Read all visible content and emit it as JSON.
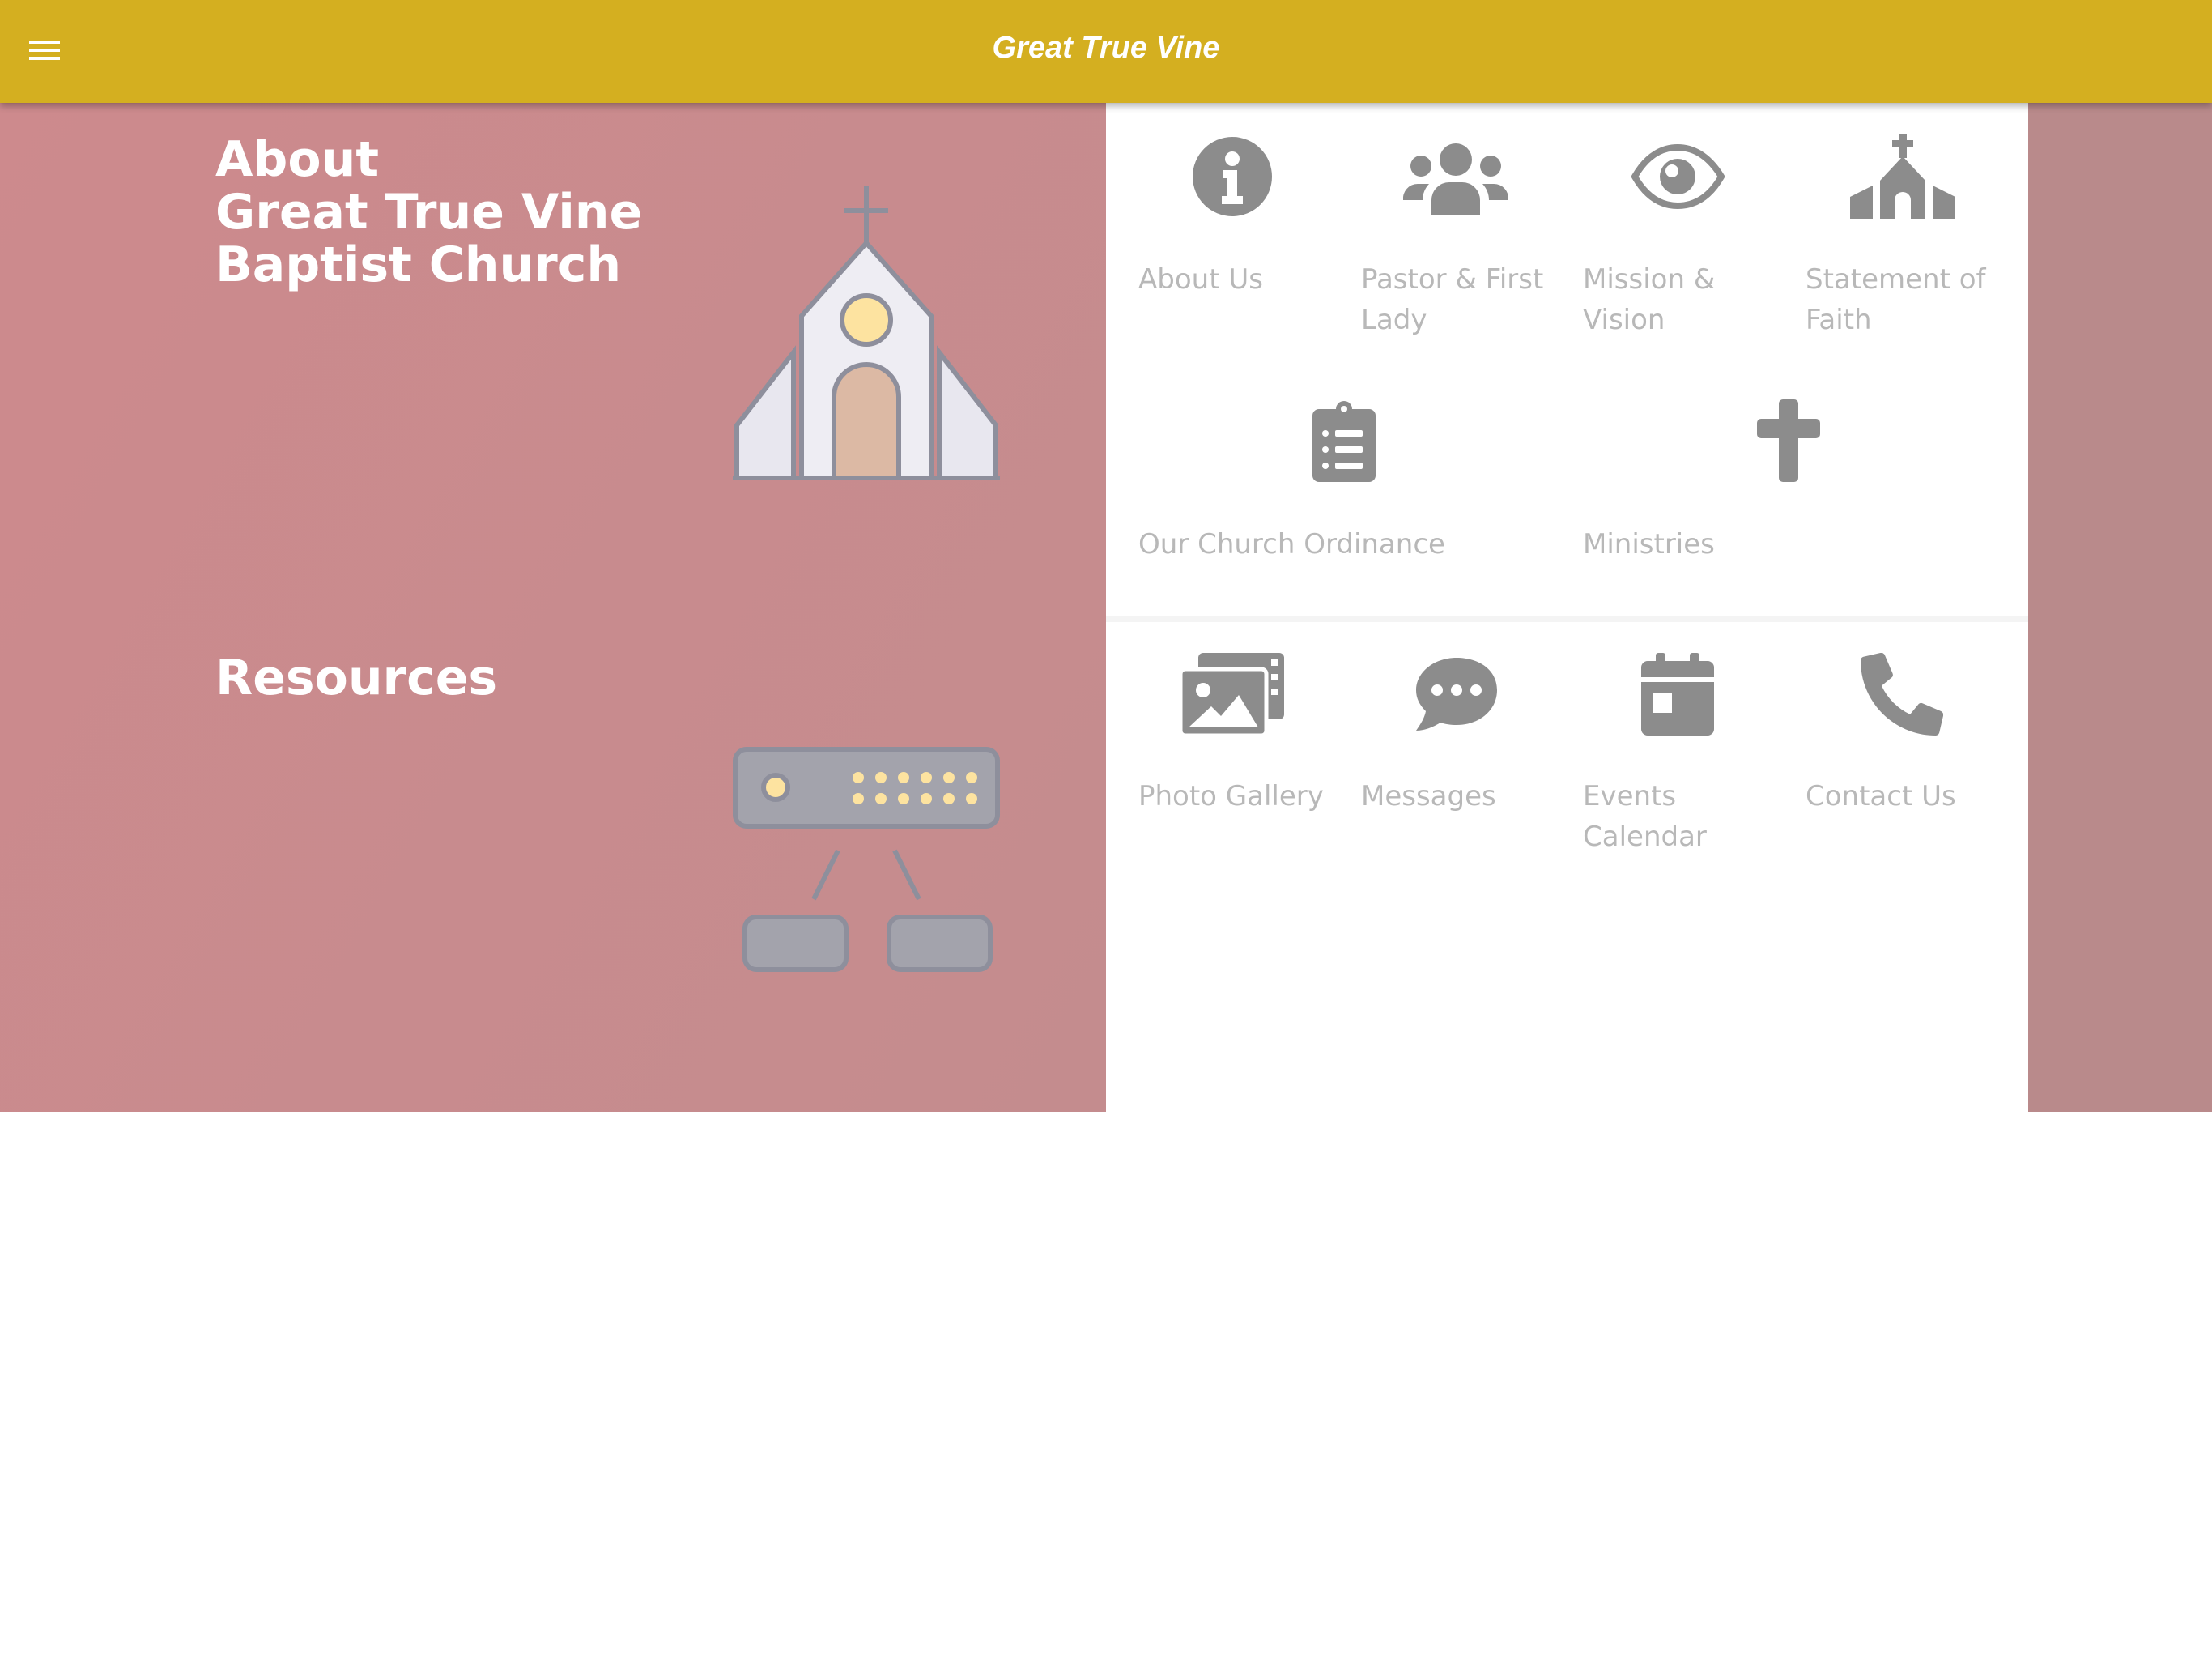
{
  "header": {
    "title": "Great True Vine",
    "menu_icon": "hamburger-menu-icon"
  },
  "about": {
    "heading_lines": [
      "About",
      "Great True Vine",
      "Baptist Church"
    ]
  },
  "resources": {
    "heading": "Resources"
  },
  "about_items": [
    {
      "label_lines": [
        "About Us"
      ],
      "icon": "info-circle-icon"
    },
    {
      "label_lines": [
        "Pastor & First",
        "Lady"
      ],
      "icon": "users-icon"
    },
    {
      "label_lines": [
        "Mission &",
        "Vision"
      ],
      "icon": "eye-icon"
    },
    {
      "label_lines": [
        "Statement of",
        "Faith"
      ],
      "icon": "church-icon"
    },
    {
      "label_lines": [
        "Our Church Ordinance"
      ],
      "icon": "clipboard-list-icon"
    },
    {
      "label_lines": [
        "Ministries"
      ],
      "icon": "cross-icon"
    }
  ],
  "resource_items": [
    {
      "label_lines": [
        "Photo Gallery"
      ],
      "icon": "images-icon"
    },
    {
      "label_lines": [
        "Messages"
      ],
      "icon": "comment-dots-icon"
    },
    {
      "label_lines": [
        "Events",
        "Calendar"
      ],
      "icon": "calendar-icon"
    },
    {
      "label_lines": [
        "Contact Us"
      ],
      "icon": "phone-icon"
    }
  ],
  "colors": {
    "header": "#D4AF20",
    "left_panel": "#C98B8D",
    "icon": "#8C8C8C",
    "label": "#B8B8B8"
  }
}
